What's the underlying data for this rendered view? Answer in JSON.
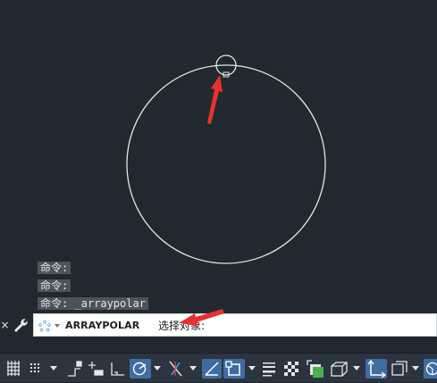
{
  "command_history": [
    "命令:",
    "命令:",
    "命令: _arraypolar"
  ],
  "command_line": {
    "close_glyph": "×",
    "command_name": "ARRAYPOLAR",
    "prompt": "选择对象:"
  },
  "status_toggles": [
    {
      "icon": "grid-icon",
      "active": false
    },
    {
      "icon": "snap-mode-icon",
      "active": false
    },
    {
      "icon": "snap-mode-dropdown-icon",
      "active": false
    },
    {
      "icon": "infer-constraints-icon",
      "active": false
    },
    {
      "icon": "dynamic-input-icon",
      "active": false
    },
    {
      "icon": "ortho-mode-icon",
      "active": false
    },
    {
      "icon": "polar-tracking-icon",
      "active": true
    },
    {
      "icon": "polar-tracking-dropdown-icon",
      "active": false
    },
    {
      "icon": "isometric-drafting-icon",
      "active": false
    },
    {
      "icon": "isometric-dropdown-icon",
      "active": false
    },
    {
      "icon": "object-snap-tracking-icon",
      "active": true
    },
    {
      "icon": "object-snap-icon",
      "active": true
    },
    {
      "icon": "object-snap-dropdown-icon",
      "active": false
    },
    {
      "icon": "lineweight-icon",
      "active": false
    },
    {
      "icon": "transparency-icon",
      "active": false
    },
    {
      "icon": "selection-cycling-icon",
      "active": false
    },
    {
      "icon": "3d-object-snap-icon",
      "active": false
    },
    {
      "icon": "3d-object-snap-dropdown-icon",
      "active": false
    },
    {
      "icon": "dynamic-ucs-icon",
      "active": true
    },
    {
      "icon": "selection-filter-icon",
      "active": false
    },
    {
      "icon": "selection-filter-dropdown-icon",
      "active": false
    },
    {
      "icon": "gizmo-icon",
      "active": false
    }
  ],
  "colors": {
    "canvas": "#212830",
    "annotation_arrow": "#e8312e",
    "active_toggle": "#3f6ca3",
    "geometry": "#e6e6e6"
  }
}
